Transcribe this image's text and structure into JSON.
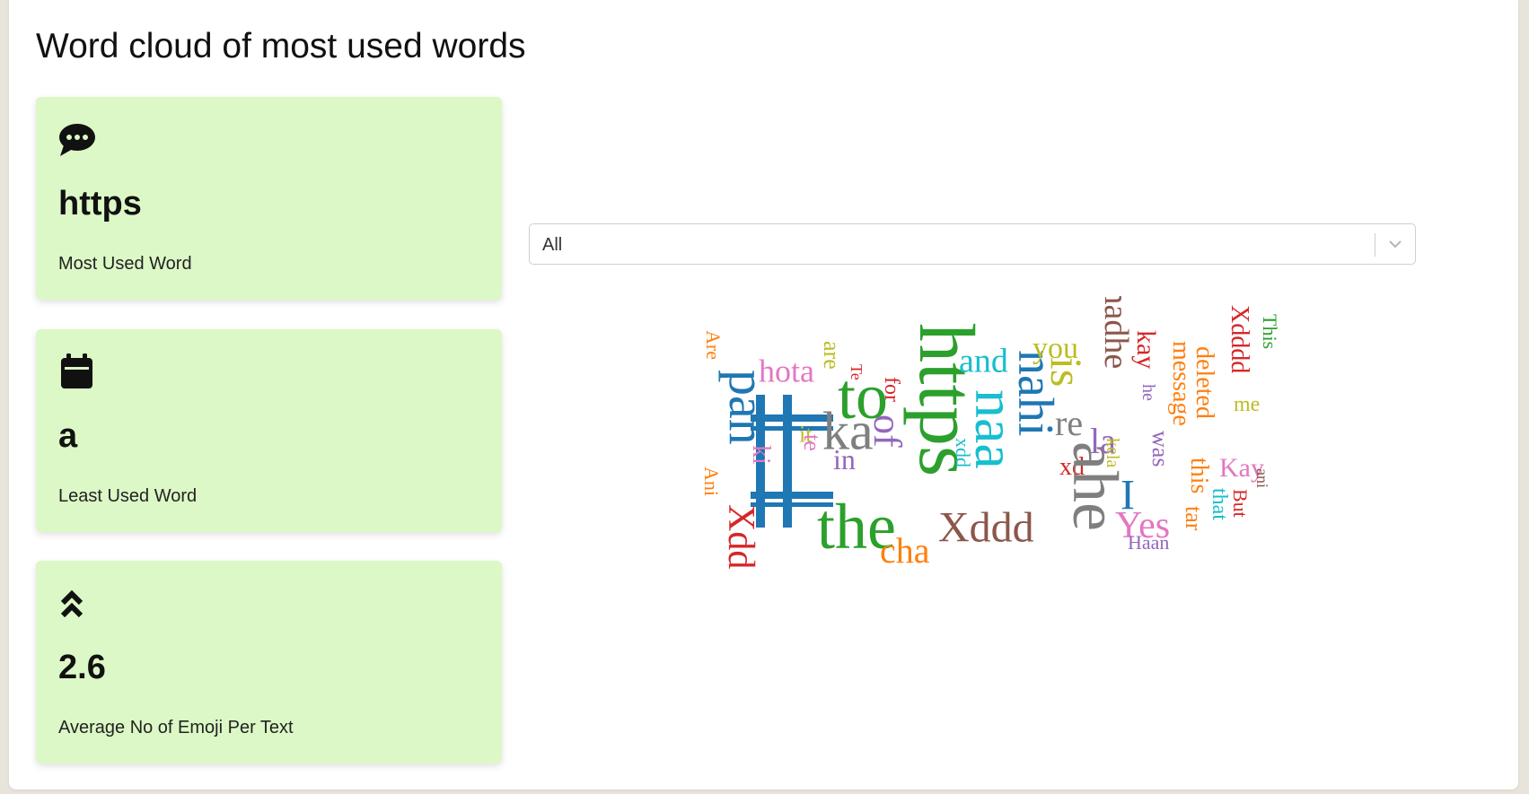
{
  "page": {
    "title": "Word cloud of most used words"
  },
  "cards": [
    {
      "value": "https",
      "label": "Most Used Word",
      "icon": "chat-bubble-icon"
    },
    {
      "value": "a",
      "label": "Least Used Word",
      "icon": "calendar-icon"
    },
    {
      "value": "2.6",
      "label": "Average No of Emoji Per Text",
      "icon": "double-chevron-up-icon"
    }
  ],
  "filter": {
    "selected": "All"
  },
  "word_cloud": {
    "words": [
      {
        "text": "Are",
        "color": "#ff7f0e"
      },
      {
        "text": "pan",
        "color": "#1f77b4"
      },
      {
        "text": "Ani",
        "color": "#ff7f0e"
      },
      {
        "text": "Xdd",
        "color": "#d62728"
      },
      {
        "text": "hota",
        "color": "#e377c2"
      },
      {
        "text": "ki",
        "color": "#e377c2"
      },
      {
        "text": "it",
        "color": "#bcbd22"
      },
      {
        "text": "are",
        "color": "#bcbd22"
      },
      {
        "text": "te",
        "color": "#e377c2"
      },
      {
        "text": "Te",
        "color": "#d62728"
      },
      {
        "text": "ka",
        "color": "#7f7f7f"
      },
      {
        "text": "to",
        "color": "#2ca02c"
      },
      {
        "text": "for",
        "color": "#d62728"
      },
      {
        "text": "in",
        "color": "#9467bd"
      },
      {
        "text": "of",
        "color": "#9467bd"
      },
      {
        "text": "the",
        "color": "#2ca02c"
      },
      {
        "text": "cha",
        "color": "#ff7f0e"
      },
      {
        "text": "https",
        "color": "#2ca02c"
      },
      {
        "text": "and",
        "color": "#17becf"
      },
      {
        "text": "naa",
        "color": "#17becf"
      },
      {
        "text": "xdd",
        "color": "#17becf"
      },
      {
        "text": "nahi",
        "color": "#1f77b4"
      },
      {
        "text": "Xddd",
        "color": "#8c564b"
      },
      {
        "text": "you",
        "color": "#bcbd22"
      },
      {
        "text": "is",
        "color": "#bcbd22"
      },
      {
        "text": "re",
        "color": "#7f7f7f"
      },
      {
        "text": "xd",
        "color": "#d62728"
      },
      {
        "text": "ahe",
        "color": "#7f7f7f"
      },
      {
        "text": "madhe",
        "color": "#8c564b"
      },
      {
        "text": "la",
        "color": "#9467bd"
      },
      {
        "text": "kela",
        "color": "#bcbd22"
      },
      {
        "text": "I",
        "color": "#1f77b4"
      },
      {
        "text": "kay",
        "color": "#d62728"
      },
      {
        "text": "he",
        "color": "#9467bd"
      },
      {
        "text": "Yes",
        "color": "#e377c2"
      },
      {
        "text": "Haan",
        "color": "#9467bd"
      },
      {
        "text": "was",
        "color": "#9467bd"
      },
      {
        "text": "message",
        "color": "#ff7f0e"
      },
      {
        "text": "deleted",
        "color": "#ff7f0e"
      },
      {
        "text": "this",
        "color": "#ff7f0e"
      },
      {
        "text": "tar",
        "color": "#ff7f0e"
      },
      {
        "text": "that",
        "color": "#17becf"
      },
      {
        "text": "Xdddd",
        "color": "#d62728"
      },
      {
        "text": "me",
        "color": "#bcbd22"
      },
      {
        "text": "Kay",
        "color": "#e377c2"
      },
      {
        "text": "But",
        "color": "#d62728"
      },
      {
        "text": "ani",
        "color": "#8c564b"
      },
      {
        "text": "This",
        "color": "#2ca02c"
      }
    ]
  }
}
